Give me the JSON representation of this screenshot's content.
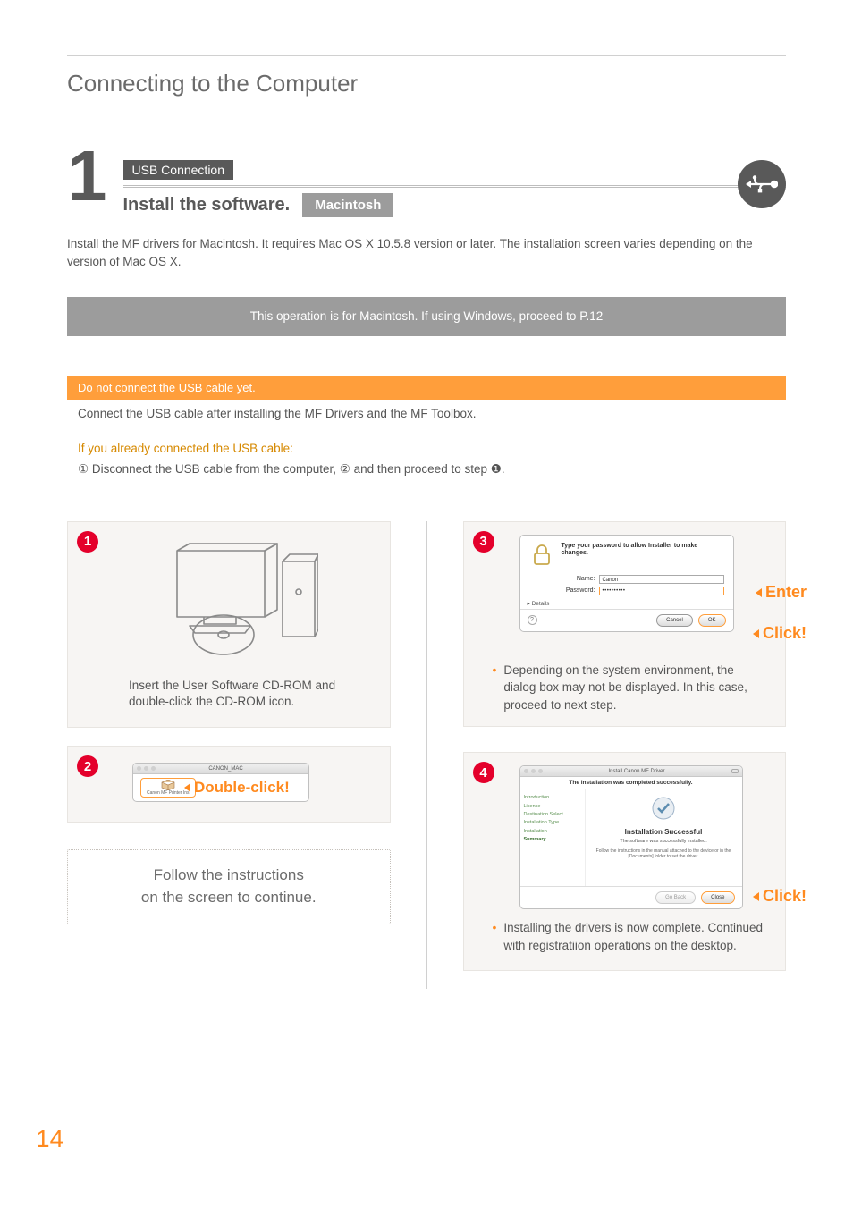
{
  "page_title": "Connecting to the Computer",
  "page_number": "14",
  "step": {
    "number": "1",
    "badge": "USB Connection",
    "title": "Install the software.",
    "platform": "Macintosh",
    "intro": "Install the MF drivers for Macintosh. It requires Mac OS X 10.5.8 version or later. The installation screen varies depending on the version of Mac OS X."
  },
  "banner": "This operation is for Macintosh. If using Windows, proceed to P.12",
  "warn": {
    "title": "Do not connect the USB cable yet.",
    "body": "Connect the USB cable after installing the MF Drivers and the MF Toolbox."
  },
  "already": {
    "title": "If you already connected the USB cable:",
    "c1": "①",
    "part1": " Disconnect the USB cable from the computer,  ",
    "c2": "②",
    "part2": " and then proceed to step ",
    "c3": "❶",
    "part3": "."
  },
  "panels": {
    "p1": {
      "num": "1",
      "caption": "Insert the User Software CD-ROM and double-click the CD-ROM icon."
    },
    "p2": {
      "num": "2",
      "action": "Double-click!",
      "finder_title": "CANON_MAC",
      "icon_label": "Canon MF Printer Ins"
    },
    "follow": "Follow the instructions\non the screen to continue.",
    "p3": {
      "num": "3",
      "dialog_msg": "Type your password to allow Installer to make changes.",
      "name_label": "Name:",
      "name_value": "Canon",
      "pass_label": "Password:",
      "pass_value": "••••••••••",
      "details": "▸  Details",
      "help": "?",
      "cancel": "Cancel",
      "ok": "OK",
      "enter": "Enter",
      "click": "Click!",
      "note": "Depending on the system environment, the dialog box may not be displayed. In this case, proceed to next step."
    },
    "p4": {
      "num": "4",
      "win_title": "Install Canon MF Driver",
      "header": "The installation was completed successfully.",
      "sidebar": [
        "Introduction",
        "License",
        "Destination Select",
        "Installation Type",
        "Installation",
        "Summary"
      ],
      "success_title": "Installation Successful",
      "success_sub": "The software was successfully installed.",
      "success_note": "Follow the instructions in the manual attached to the device or in the [Documents] folder to set the driver.",
      "goback": "Go Back",
      "close": "Close",
      "click": "Click!",
      "note": "Installing the drivers is now complete. Continued with registratiion operations on the desktop."
    }
  }
}
